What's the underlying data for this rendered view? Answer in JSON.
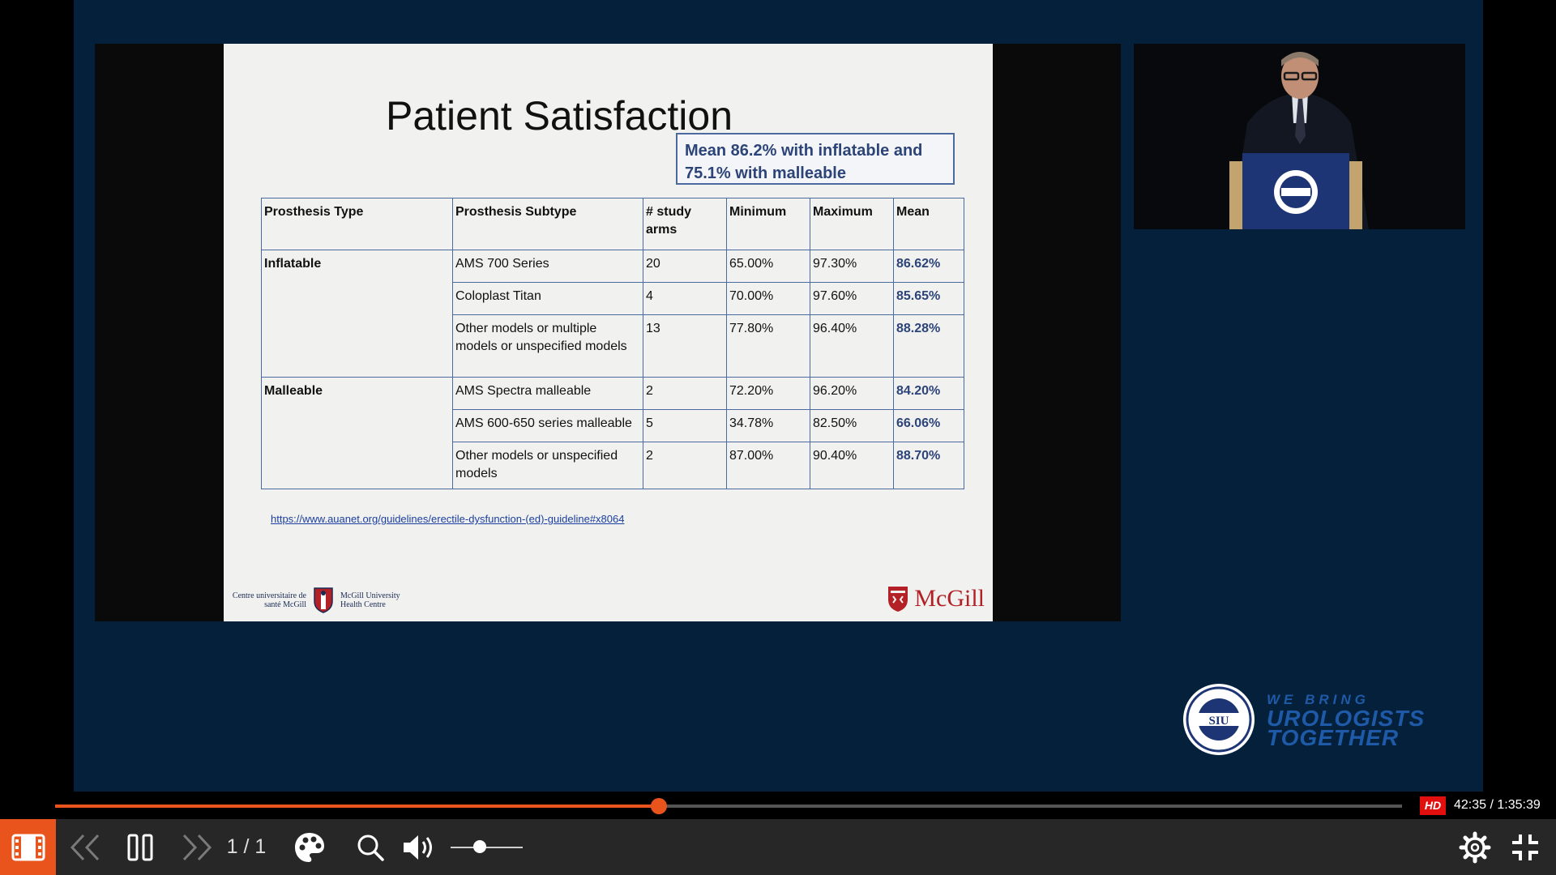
{
  "slide": {
    "title": "Patient Satisfaction",
    "callout": "Mean 86.2% with inflatable and 75.1% with malleable",
    "table": {
      "headers": [
        "Prosthesis Type",
        "Prosthesis Subtype",
        "# study arms",
        "Minimum",
        "Maximum",
        "Mean"
      ],
      "inflatable_label": "Inflatable",
      "malleable_label": "Malleable",
      "rows": [
        {
          "subtype": "AMS 700 Series",
          "arms": "20",
          "min": "65.00%",
          "max": "97.30%",
          "mean": "86.62%"
        },
        {
          "subtype": "Coloplast Titan",
          "arms": "4",
          "min": "70.00%",
          "max": "97.60%",
          "mean": "85.65%"
        },
        {
          "subtype": "Other models or multiple models or unspecified models",
          "arms": "13",
          "min": "77.80%",
          "max": "96.40%",
          "mean": "88.28%"
        },
        {
          "subtype": "AMS Spectra malleable",
          "arms": "2",
          "min": "72.20%",
          "max": "96.20%",
          "mean": "84.20%"
        },
        {
          "subtype": "AMS 600-650 series malleable",
          "arms": "5",
          "min": "34.78%",
          "max": "82.50%",
          "mean": "66.06%"
        },
        {
          "subtype": "Other models or unspecified models",
          "arms": "2",
          "min": "87.00%",
          "max": "90.40%",
          "mean": "88.70%"
        }
      ]
    },
    "link": "https://www.auanet.org/guidelines/erectile-dysfunction-(ed)-guideline#x8064",
    "footer_left_fr": "Centre universitaire de santé McGill",
    "footer_left_en": "McGill University Health Centre",
    "footer_right": "McGill"
  },
  "siu": {
    "seal_text": "SIU",
    "tagline_1": "WE BRING",
    "tagline_2": "UROLOGISTS",
    "tagline_3": "TOGETHER"
  },
  "player": {
    "progress": 0.448,
    "hd_label": "HD",
    "time": "42:35 / 1:35:39",
    "page_counter": "1 / 1",
    "volume": 0.4
  },
  "icons": {
    "slides": "film-strip-icon",
    "prev": "double-chevron-left-icon",
    "pause": "pause-icon",
    "next": "double-chevron-right-icon",
    "palette": "palette-icon",
    "zoom": "magnifier-icon",
    "volume": "speaker-icon",
    "settings": "gear-icon",
    "exit_fullscreen": "exit-fullscreen-icon"
  },
  "colors": {
    "accent": "#e8541c",
    "stage_bg": "#04203a",
    "hd_badge": "#e20f0f"
  }
}
